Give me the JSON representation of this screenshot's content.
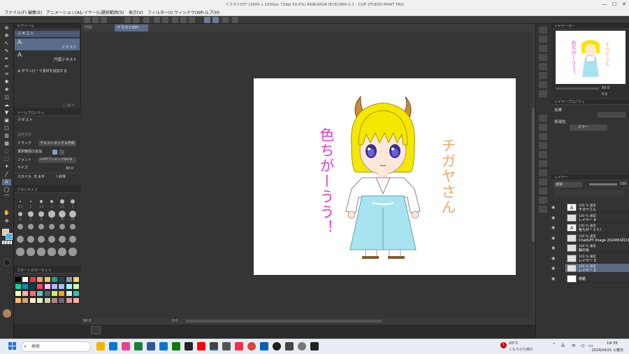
{
  "window": {
    "title": "イラスト03* (1600 x 1200px 72dpi 50.0%) RGB/sRGB IEC61966-2.1 - CLIP STUDIO PAINT PRO",
    "controls": [
      "—",
      "☐",
      "✕"
    ]
  },
  "menu": [
    "ファイル(F)",
    "編集(E)",
    "アニメーション(A)",
    "レイヤー(L)",
    "選択範囲(S)",
    "表示(V)",
    "フィルター(I)",
    "ウィンドウ(W)",
    "ヘルプ(H)"
  ],
  "subtool": {
    "header": "サブツール",
    "group": "テキスト",
    "items": [
      {
        "label": "テキスト",
        "selected": true
      },
      {
        "label": "円弧テキスト",
        "selected": false
      }
    ],
    "download_label": "ダウンロード素材を追加する"
  },
  "tool_property": {
    "header": "ツールプロパティ",
    "title": "テキスト",
    "preset_label": "設定方法",
    "drag_label": "ドラッグ",
    "drag_value": "テキストボックス作成",
    "add_label": "選択範囲の追加",
    "font_label": "フォント",
    "font_value": "I-OTFアンチックStd B",
    "size_label": "サイズ",
    "size_value": "30.0",
    "style_label": "スタイル",
    "bold_label": "太字",
    "italic_label": "斜体"
  },
  "brush_size": {
    "header": "ブラシサイズ",
    "sizes": [
      "0.7",
      "1",
      "1.5",
      "2",
      "2.5",
      "3",
      "4",
      "5",
      "6",
      "7",
      "8",
      "10"
    ]
  },
  "color_set": {
    "header": "スタートカラーセット",
    "colors": [
      "#000000",
      "#ffffff",
      "#e63946",
      "#f4a261",
      "#e9c46a",
      "#2a9d8f",
      "#264653",
      "#8d99ae",
      "#ffd166",
      "#06d6a0",
      "#118ab2",
      "#073b4c",
      "#ef476f",
      "#ffc6ff",
      "#bdb2ff",
      "#a0c4ff",
      "#9bf6ff",
      "#caffbf",
      "#fdffb6",
      "#ffadad",
      "#ff6b6b",
      "#4ecdc4",
      "#556270",
      "#c7f464",
      "#ff9f1c",
      "#cbf3f0",
      "#2ec4b6",
      "#ffbf69",
      "#d4a373",
      "#faedcd",
      "#e9edc9",
      "#ccd5ae",
      "#b5838d",
      "#6d6875",
      "#e5989b",
      "#ffb4a2"
    ]
  },
  "doc_tabs": [
    {
      "label": "円形",
      "active": false
    },
    {
      "label": "イラスト03*",
      "active": true
    }
  ],
  "artwork": {
    "text_right": "チガヤさん",
    "text_left": "色ちがーうう！",
    "text_right_color": "#f0a868",
    "text_left_color": "#e040c8",
    "hair_color": "#f5e800",
    "hakama_color": "#a8e4f0",
    "horn_color": "#c98a3a"
  },
  "status": {
    "zoom": "50.0",
    "angle": "0.0"
  },
  "navigator": {
    "header": "ナビゲーター",
    "zoom": "50.0",
    "rotate": "0.0"
  },
  "layer_property": {
    "header": "レイヤープロパティ",
    "effect_label": "効果",
    "color_label": "表現色",
    "color_value": "カラー"
  },
  "layers": {
    "header": "レイヤー",
    "blend": "通常",
    "opacity": "100",
    "items": [
      {
        "l1": "100 % 通常",
        "l2": "チガヤさん",
        "selected": false,
        "type": "text"
      },
      {
        "l1": "100 % 通常",
        "l2": "レイヤー 4",
        "selected": false,
        "type": "raster"
      },
      {
        "l1": "100 % 通常",
        "l2": "色ちがーうう！",
        "selected": false,
        "type": "text"
      },
      {
        "l1": "100 % 通常",
        "l2": "ChatGPT Image 2024年4月21日",
        "selected": false,
        "type": "raster"
      },
      {
        "l1": "100 % 通常",
        "l2": "脳の色",
        "selected": false,
        "type": "raster"
      },
      {
        "l1": "100 % 通常",
        "l2": "レイヤー 3",
        "selected": false,
        "type": "raster"
      },
      {
        "l1": "100 % 通常",
        "l2": "レイヤー 2",
        "selected": true,
        "type": "raster"
      },
      {
        "l1": "",
        "l2": "用紙",
        "selected": false,
        "type": "paper"
      }
    ]
  },
  "taskbar": {
    "search_placeholder": "検索",
    "weather_temp": "20°C",
    "weather_text": "くもりのち晴れ",
    "ime": "A",
    "time": "18:35",
    "date": "2024/04/21 火曜日",
    "notification_count": "1"
  }
}
